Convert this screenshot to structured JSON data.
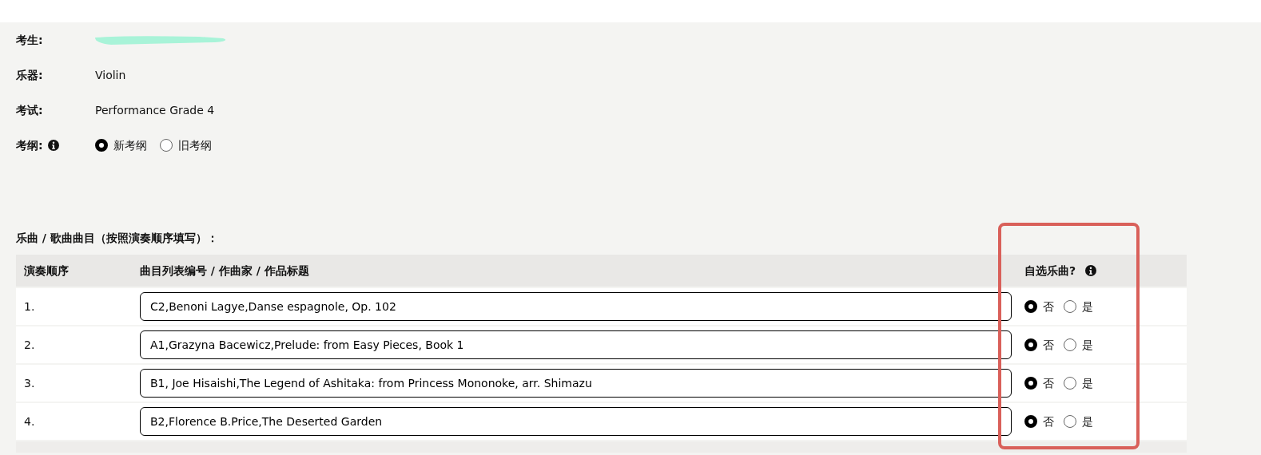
{
  "candidate": {
    "fields": [
      {
        "label": "考生:",
        "kind": "redacted"
      },
      {
        "label": "乐器:",
        "kind": "text",
        "value": "Violin"
      },
      {
        "label": "考试:",
        "kind": "text",
        "value": "Performance Grade 4"
      },
      {
        "label": "考纲:",
        "kind": "radio",
        "info": true,
        "options": [
          {
            "label": "新考纲",
            "selected": true
          },
          {
            "label": "旧考纲",
            "selected": false
          }
        ]
      }
    ]
  },
  "repertoire": {
    "title": "乐曲 / 歌曲曲目（按照演奏顺序填写）：",
    "columns": [
      "演奏顺序",
      "曲目列表编号 / 作曲家 / 作品标题",
      "自选乐曲?"
    ],
    "rows": [
      {
        "order": "1.",
        "value": "C2,Benoni Lagye,Danse espagnole, Op. 102",
        "options": [
          {
            "label": "否",
            "selected": true
          },
          {
            "label": "是",
            "selected": false
          }
        ]
      },
      {
        "order": "2.",
        "value": "A1,Grazyna Bacewicz,Prelude: from Easy Pieces, Book 1",
        "options": [
          {
            "label": "否",
            "selected": true
          },
          {
            "label": "是",
            "selected": false
          }
        ]
      },
      {
        "order": "3.",
        "value": "B1, Joe Hisaishi,The Legend of Ashitaka: from Princess Mononoke, arr. Shimazu",
        "options": [
          {
            "label": "否",
            "selected": true
          },
          {
            "label": "是",
            "selected": false
          }
        ]
      },
      {
        "order": "4.",
        "value": "B2,Florence B.Price,The Deserted Garden",
        "options": [
          {
            "label": "否",
            "selected": true
          },
          {
            "label": "是",
            "selected": false
          }
        ]
      }
    ]
  }
}
